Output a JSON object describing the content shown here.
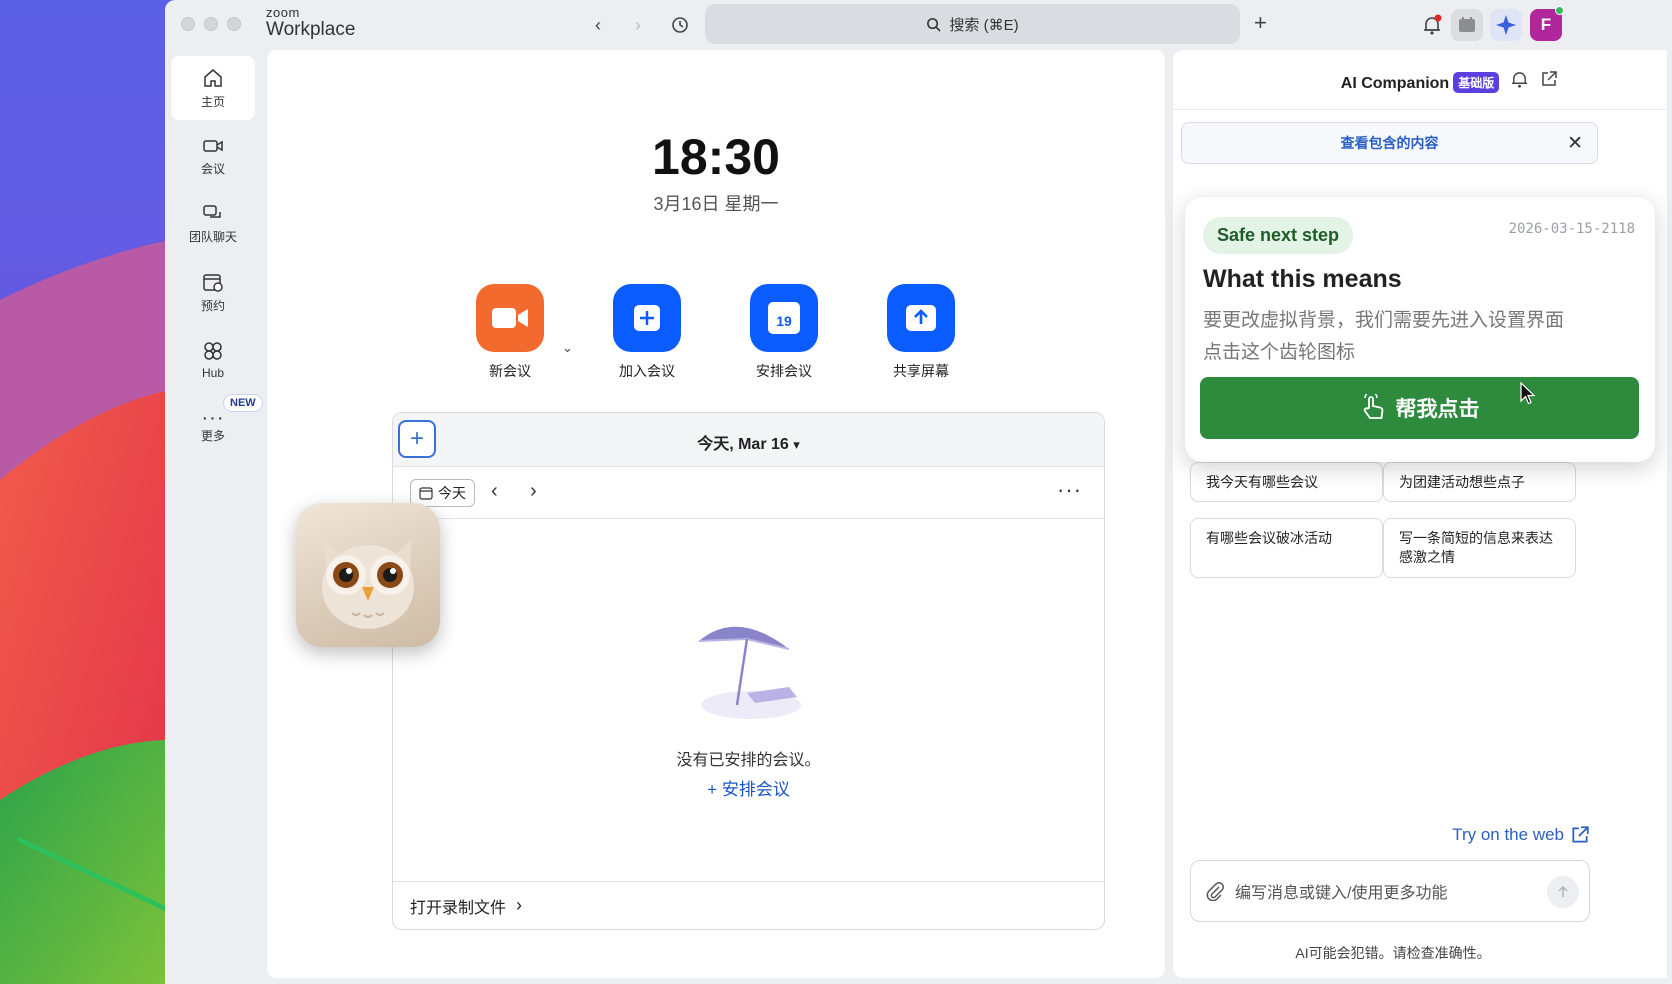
{
  "window": {
    "brand_top": "zoom",
    "brand_bottom": "Workplace",
    "search_placeholder": "搜索 (⌘E)"
  },
  "sidebar": {
    "items": [
      {
        "label": "主页",
        "icon": "home-icon"
      },
      {
        "label": "会议",
        "icon": "video-icon"
      },
      {
        "label": "团队聊天",
        "icon": "chat-icon"
      },
      {
        "label": "预约",
        "icon": "calendar-clock-icon"
      },
      {
        "label": "Hub",
        "icon": "hub-icon"
      },
      {
        "label": "更多",
        "icon": "more-icon"
      }
    ],
    "new_badge": "NEW"
  },
  "main": {
    "time": "18:30",
    "date": "3月16日 星期一",
    "actions": [
      {
        "label": "新会议",
        "color": "#f26a2e",
        "icon": "video-camera-icon"
      },
      {
        "label": "加入会议",
        "color": "#0b5cff",
        "icon": "plus-icon"
      },
      {
        "label": "安排会议",
        "color": "#0b5cff",
        "icon": "calendar-icon",
        "icon_text": "19"
      },
      {
        "label": "共享屏幕",
        "color": "#0b5cff",
        "icon": "share-up-icon"
      }
    ],
    "calendar": {
      "title": "今天, Mar 16",
      "today_button": "今天",
      "empty_text": "没有已安排的会议。",
      "schedule_link": "安排会议",
      "footer": "打开录制文件"
    }
  },
  "companion": {
    "title": "AI Companion",
    "badge": "基础版",
    "info_link": "查看包含的内容",
    "chips": [
      "我今天有哪些会议",
      "为团建活动想些点子",
      "有哪些会议破冰活动",
      "写一条简短的信息来表达感激之情"
    ],
    "try_web": "Try on the web",
    "composer_placeholder": "编写消息或键入/使用更多功能",
    "disclaimer": "AI可能会犯错。请检查准确性。"
  },
  "guide_card": {
    "tag": "Safe next step",
    "timestamp": "2026-03-15-2118",
    "title": "What this means",
    "line1": "要更改虚拟背景，我们需要先进入设置界面",
    "line2": "点击这个齿轮图标",
    "button": "帮我点击"
  },
  "colors": {
    "accent": "#0b5cff",
    "orange": "#f26a2e",
    "guide_green": "#2e8b3e",
    "companion_purple": "#5b3fe0"
  }
}
